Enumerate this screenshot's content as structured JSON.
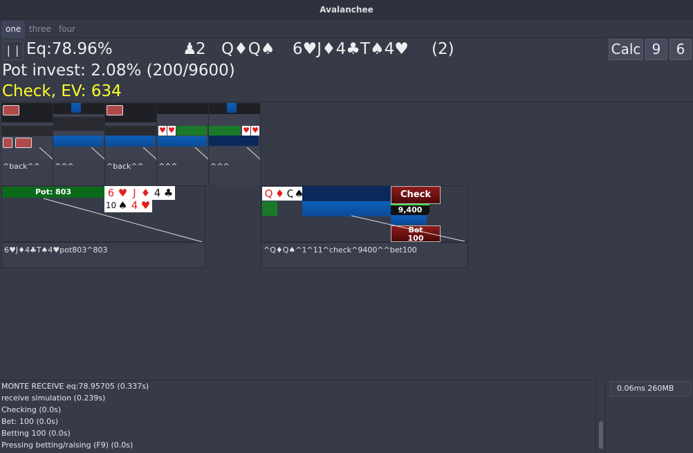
{
  "window": {
    "title": "Avalanchee"
  },
  "tabs": [
    {
      "label": "one",
      "active": true
    },
    {
      "label": "three",
      "active": false
    },
    {
      "label": "four",
      "active": false
    }
  ],
  "info": {
    "pause_symbol": "| |",
    "equity": "Eq:78.96%",
    "players_icon": "♟",
    "players_count": "2",
    "hand": "Q♦Q♠",
    "board": "6♥J♦4♣T♠4♥",
    "board_count": "(2)",
    "pot_invest": "Pot invest: 2.08% (200/9600)",
    "decision": "Check, EV: 634",
    "decision_color": "#ffff2a",
    "buttons": {
      "calc": "Calc",
      "nine": "9",
      "six": "6"
    }
  },
  "thumbnails": [
    {
      "caption": "^back^^"
    },
    {
      "caption": "^^^"
    },
    {
      "caption": "^back^^"
    },
    {
      "caption": "^^^"
    },
    {
      "caption": "^^^"
    }
  ],
  "board_panel": {
    "pot_label": "Pot: 803",
    "caption": "6♥J♦4♣T♠4♥pot803^803",
    "cards_top": [
      {
        "rank": "6",
        "suit": "♥",
        "red": true
      },
      {
        "rank": "",
        "suit": "♥",
        "red": true
      },
      {
        "rank": "J",
        "suit": "♦",
        "red": true
      },
      {
        "rank": "4",
        "suit": "",
        "red": false
      },
      {
        "rank": "",
        "suit": "♣",
        "red": false
      }
    ],
    "cards_bottom": [
      {
        "rank": "10",
        "suit": "",
        "red": false
      },
      {
        "rank": "",
        "suit": "♠",
        "red": false
      },
      {
        "rank": "4",
        "suit": "",
        "red": true
      },
      {
        "rank": "",
        "suit": "♥",
        "red": true
      }
    ]
  },
  "hero_panel": {
    "cards": [
      {
        "rank": "Q",
        "suit": "♦",
        "red": true
      },
      {
        "rank": "Q",
        "suit": "♠",
        "red": false
      }
    ],
    "check_label": "Check",
    "stack": "9,400",
    "bet_label": "Bet",
    "bet_amount": "100",
    "caption": "^Q♦Q♠^1^11^check^9400^^bet100"
  },
  "log": [
    "MONTE RECEIVE eq:78.95705 (0.337s)",
    "receive simulation (0.239s)",
    "Checking (0.0s)",
    "Bet: 100 (0.0s)",
    "Betting 100 (0.0s)",
    "Pressing betting/raising (F9) (0.0s)"
  ],
  "stats": "0.06ms 260MB"
}
